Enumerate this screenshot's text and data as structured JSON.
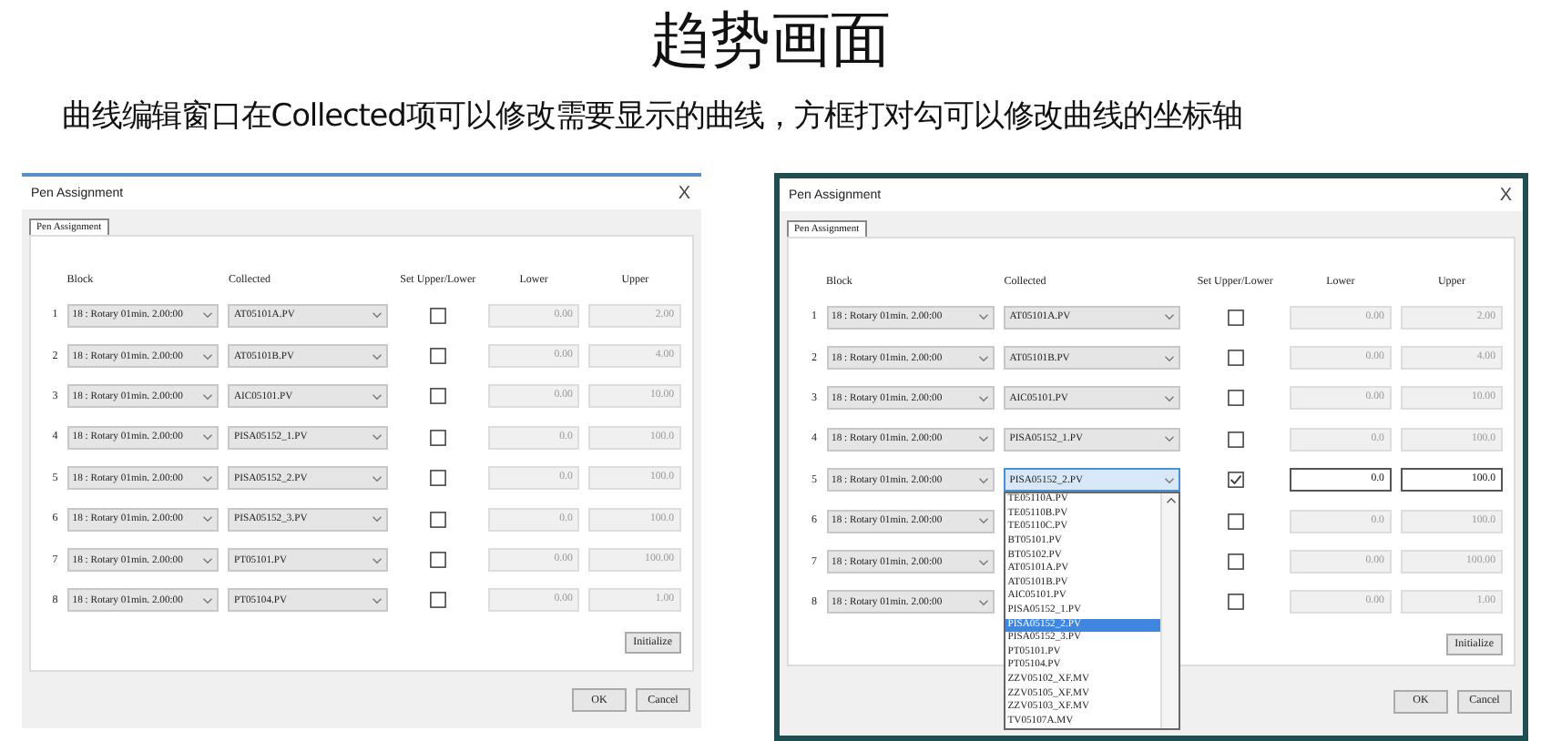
{
  "slide": {
    "title": "趋势画面",
    "caption": "曲线编辑窗口在Collected项可以修改需要显示的曲线，方框打对勾可以修改曲线的坐标轴"
  },
  "dialogs": [
    {
      "title": "Pen Assignment",
      "close": "X",
      "tabs": [
        {
          "label": "Pen Assignment",
          "selected": true
        }
      ],
      "columns": [
        "Block",
        "Collected",
        "Set Upper/Lower",
        "Lower",
        "Upper"
      ],
      "rows": [
        {
          "index": "1",
          "block": "18 : Rotary 01min. 2.00:00",
          "collected": "AT05101A.PV",
          "checked": false,
          "lower": "0.00",
          "upper": "2.00"
        },
        {
          "index": "2",
          "block": "18 : Rotary 01min. 2.00:00",
          "collected": "AT05101B.PV",
          "checked": false,
          "lower": "0.00",
          "upper": "4.00"
        },
        {
          "index": "3",
          "block": "18 : Rotary 01min. 2.00:00",
          "collected": "AIC05101.PV",
          "checked": false,
          "lower": "0.00",
          "upper": "10.00"
        },
        {
          "index": "4",
          "block": "18 : Rotary 01min. 2.00:00",
          "collected": "PISA05152_1.PV",
          "checked": false,
          "lower": "0.0",
          "upper": "100.0"
        },
        {
          "index": "5",
          "block": "18 : Rotary 01min. 2.00:00",
          "collected": "PISA05152_2.PV",
          "checked": false,
          "lower": "0.0",
          "upper": "100.0"
        },
        {
          "index": "6",
          "block": "18 : Rotary 01min. 2.00:00",
          "collected": "PISA05152_3.PV",
          "checked": false,
          "lower": "0.0",
          "upper": "100.0"
        },
        {
          "index": "7",
          "block": "18 : Rotary 01min. 2.00:00",
          "collected": "PT05101.PV",
          "checked": false,
          "lower": "0.00",
          "upper": "100.00"
        },
        {
          "index": "8",
          "block": "18 : Rotary 01min. 2.00:00",
          "collected": "PT05104.PV",
          "checked": false,
          "lower": "0.00",
          "upper": "1.00"
        }
      ],
      "initialize_button": "Initialize",
      "buttons": [
        "OK",
        "Cancel"
      ]
    },
    {
      "title": "Pen Assignment",
      "close": "X",
      "tabs": [
        {
          "label": "Pen Assignment",
          "selected": true
        }
      ],
      "columns": [
        "Block",
        "Collected",
        "Set Upper/Lower",
        "Lower",
        "Upper"
      ],
      "rows": [
        {
          "index": "1",
          "block": "18 : Rotary 01min. 2.00:00",
          "collected": "AT05101A.PV",
          "checked": false,
          "lower": "0.00",
          "upper": "2.00"
        },
        {
          "index": "2",
          "block": "18 : Rotary 01min. 2.00:00",
          "collected": "AT05101B.PV",
          "checked": false,
          "lower": "0.00",
          "upper": "4.00"
        },
        {
          "index": "3",
          "block": "18 : Rotary 01min. 2.00:00",
          "collected": "AIC05101.PV",
          "checked": false,
          "lower": "0.00",
          "upper": "10.00"
        },
        {
          "index": "4",
          "block": "18 : Rotary 01min. 2.00:00",
          "collected": "PISA05152_1.PV",
          "checked": false,
          "lower": "0.0",
          "upper": "100.0"
        },
        {
          "index": "5",
          "block": "18 : Rotary 01min. 2.00:00",
          "collected": "PISA05152_2.PV",
          "expanded": true,
          "checked": true,
          "lower": "0.0",
          "upper": "100.0",
          "dropdown": [
            {
              "label": "TE05110A.PV",
              "selected": false
            },
            {
              "label": "TE05110B.PV",
              "selected": false
            },
            {
              "label": "TE05110C.PV",
              "selected": false
            },
            {
              "label": "BT05101.PV",
              "selected": false
            },
            {
              "label": "BT05102.PV",
              "selected": false
            },
            {
              "label": "AT05101A.PV",
              "selected": false
            },
            {
              "label": "AT05101B.PV",
              "selected": false
            },
            {
              "label": "AIC05101.PV",
              "selected": false
            },
            {
              "label": "PISA05152_1.PV",
              "selected": false
            },
            {
              "label": "PISA05152_2.PV",
              "selected": true
            },
            {
              "label": "PISA05152_3.PV",
              "selected": false
            },
            {
              "label": "PT05101.PV",
              "selected": false
            },
            {
              "label": "PT05104.PV",
              "selected": false
            },
            {
              "label": "ZZV05102_XF.MV",
              "selected": false
            },
            {
              "label": "ZZV05105_XF.MV",
              "selected": false
            },
            {
              "label": "ZZV05103_XF.MV",
              "selected": false
            },
            {
              "label": "TV05107A.MV",
              "selected": false
            }
          ]
        },
        {
          "index": "6",
          "block": "18 : Rotary 01min. 2.00:00",
          "checked": false,
          "lower": "0.0",
          "upper": "100.0"
        },
        {
          "index": "7",
          "block": "18 : Rotary 01min. 2.00:00",
          "checked": false,
          "lower": "0.00",
          "upper": "100.00"
        },
        {
          "index": "8",
          "block": "18 : Rotary 01min. 2.00:00",
          "checked": false,
          "lower": "0.00",
          "upper": "1.00"
        }
      ],
      "initialize_button": "Initialize",
      "buttons": [
        "OK",
        "Cancel"
      ]
    }
  ]
}
